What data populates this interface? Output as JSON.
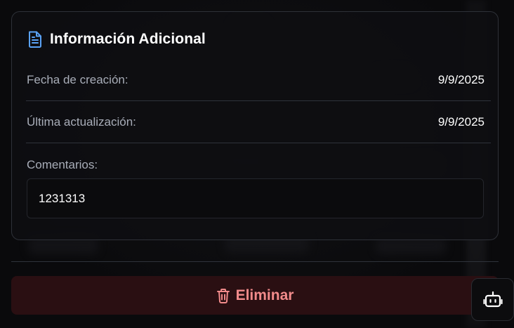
{
  "card": {
    "title": "Información Adicional",
    "icon": "document-icon",
    "rows": [
      {
        "label": "Fecha de creación:",
        "value": "9/9/2025"
      },
      {
        "label": "Última actualización:",
        "value": "9/9/2025"
      }
    ],
    "comments": {
      "label": "Comentarios:",
      "value": "1231313"
    }
  },
  "actions": {
    "delete_label": "Eliminar",
    "delete_icon": "trash-icon"
  },
  "assistant": {
    "icon": "bot-icon"
  },
  "colors": {
    "accent_blue": "#5aa2f5",
    "danger_text": "#f28b8b",
    "danger_bg": "#2a0f12"
  }
}
